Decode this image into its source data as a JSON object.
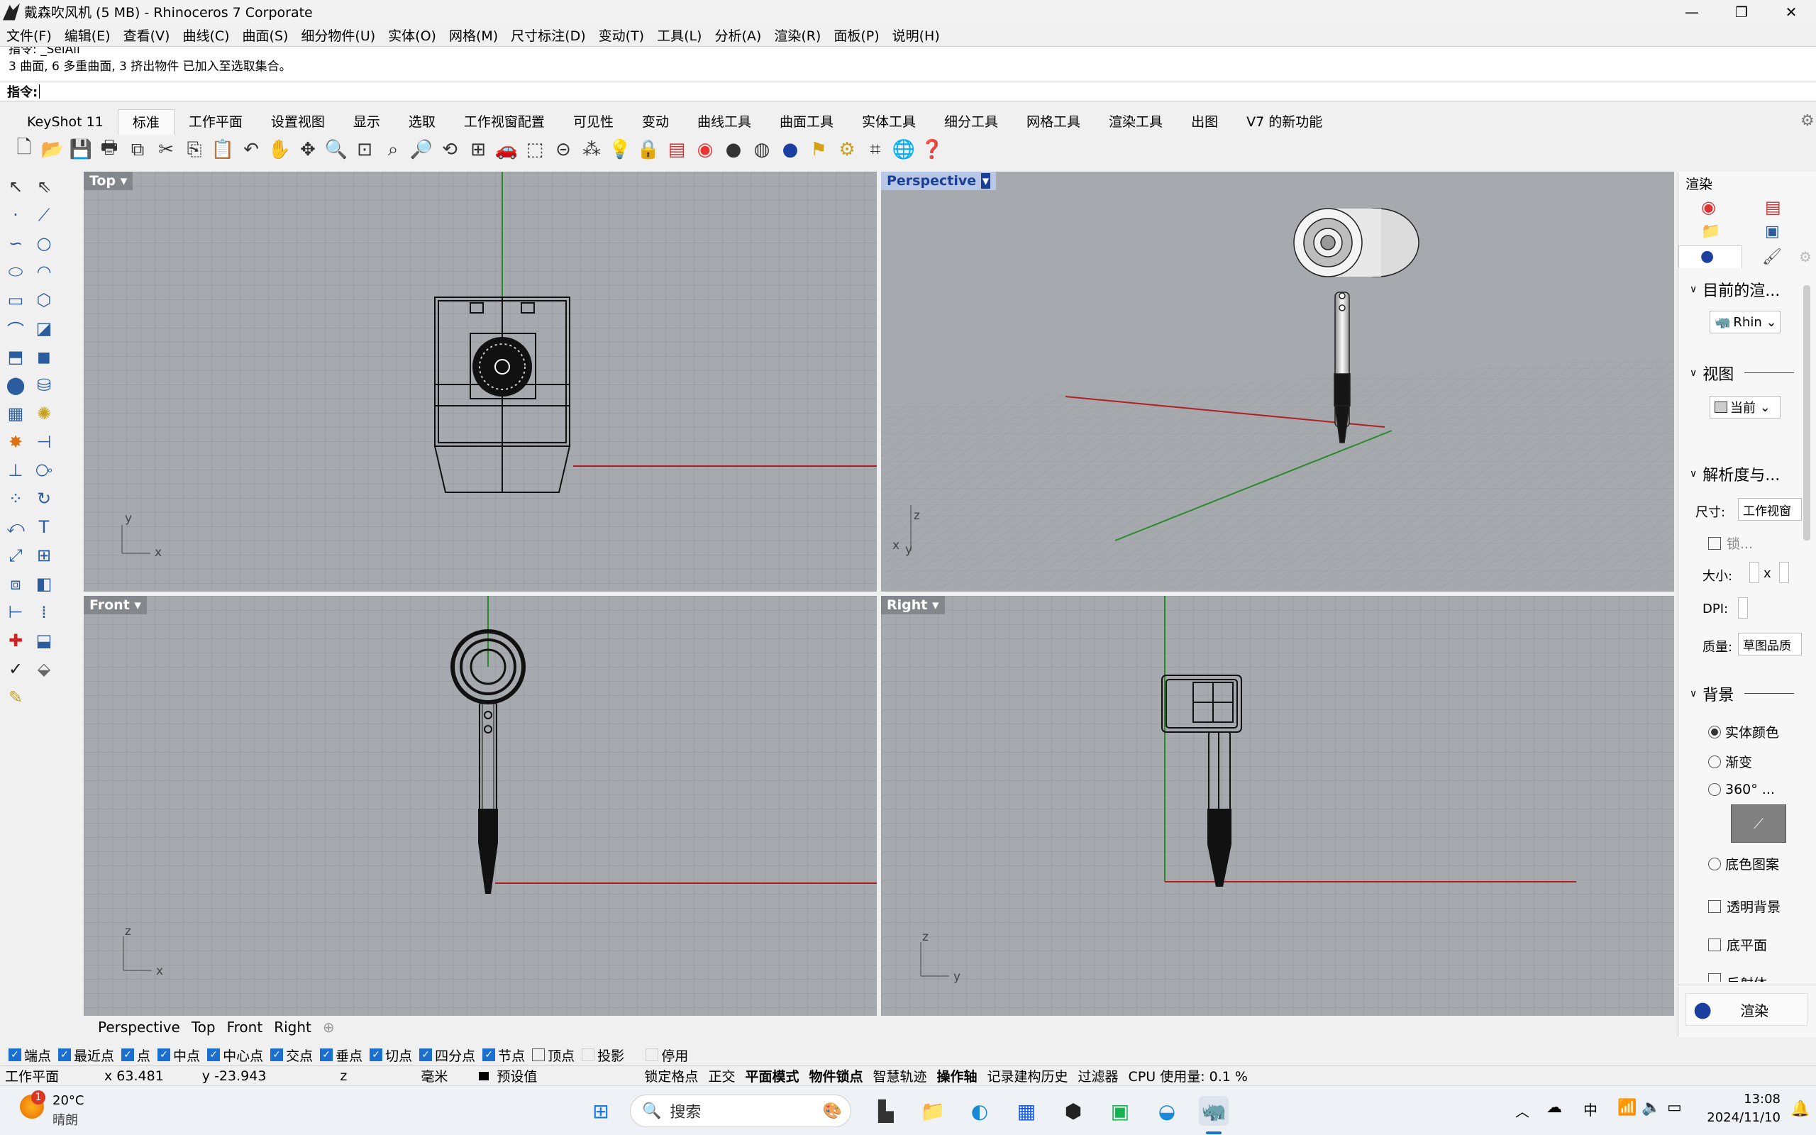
{
  "window": {
    "title": "戴森吹风机 (5 MB) - Rhinoceros 7 Corporate",
    "minimize": "—",
    "maximize": "❐",
    "close": "✕"
  },
  "menu": [
    "文件(F)",
    "编辑(E)",
    "查看(V)",
    "曲线(C)",
    "曲面(S)",
    "细分物件(U)",
    "实体(O)",
    "网格(M)",
    "尺寸标注(D)",
    "变动(T)",
    "工具(L)",
    "分析(A)",
    "渲染(R)",
    "面板(P)",
    "说明(H)"
  ],
  "command": {
    "history1": "指令: _SelAll",
    "history2": "3 曲面, 6 多重曲面, 3 挤出物件 已加入至选取集合。",
    "prompt": "指令:"
  },
  "tabs": [
    "KeyShot 11",
    "标准",
    "工作平面",
    "设置视图",
    "显示",
    "选取",
    "工作视窗配置",
    "可见性",
    "变动",
    "曲线工具",
    "曲面工具",
    "实体工具",
    "细分工具",
    "网格工具",
    "渲染工具",
    "出图",
    "V7 的新功能"
  ],
  "active_tab": "标准",
  "viewports": {
    "top": "Top",
    "perspective": "Perspective",
    "front": "Front",
    "right": "Right"
  },
  "axis": {
    "x": "x",
    "y": "y",
    "z": "z"
  },
  "viewport_tabs": [
    "Perspective",
    "Top",
    "Front",
    "Right"
  ],
  "osnap": [
    {
      "label": "端点",
      "on": true
    },
    {
      "label": "最近点",
      "on": true
    },
    {
      "label": "点",
      "on": true
    },
    {
      "label": "中点",
      "on": true
    },
    {
      "label": "中心点",
      "on": true
    },
    {
      "label": "交点",
      "on": true
    },
    {
      "label": "垂点",
      "on": true
    },
    {
      "label": "切点",
      "on": true
    },
    {
      "label": "四分点",
      "on": true
    },
    {
      "label": "节点",
      "on": true
    },
    {
      "label": "顶点",
      "on": false
    },
    {
      "label": "投影",
      "on": false
    },
    {
      "label": "停用",
      "on": false
    }
  ],
  "status": {
    "cplane": "工作平面",
    "x": "x 63.481",
    "y": "y -23.943",
    "z": "z",
    "unit": "毫米",
    "layer": "预设值",
    "grid": "锁定格点",
    "ortho": "正交",
    "planar": "平面模式",
    "osnap": "物件锁点",
    "smarttrack": "智慧轨迹",
    "gumball": "操作轴",
    "history": "记录建构历史",
    "filter": "过滤器",
    "cpu": "CPU 使用量: 0.1 %"
  },
  "render_panel": {
    "title": "渲染",
    "target": "目前的渲...",
    "target_value": "Rhin",
    "view": "视图",
    "view_value": "当前",
    "resolution": "解析度与...",
    "size": "尺寸:",
    "size_value": "工作视窗",
    "lock": "锁...",
    "dims": "大小:",
    "dims_x": "x",
    "dpi": "DPI:",
    "quality": "质量:",
    "quality_value": "草图品质",
    "background": "背景",
    "solid": "实体颜色",
    "gradient": "渐变",
    "env360": "360° ...",
    "bgimage": "底色图案",
    "transparent": "透明背景",
    "ground": "底平面",
    "reflect": "反射体",
    "render_btn": "渲染"
  },
  "taskbar": {
    "temp": "20°C",
    "weather": "晴朗",
    "badge": "1",
    "search": "搜索",
    "ime": "中",
    "time": "13:08",
    "date": "2024/11/10"
  }
}
